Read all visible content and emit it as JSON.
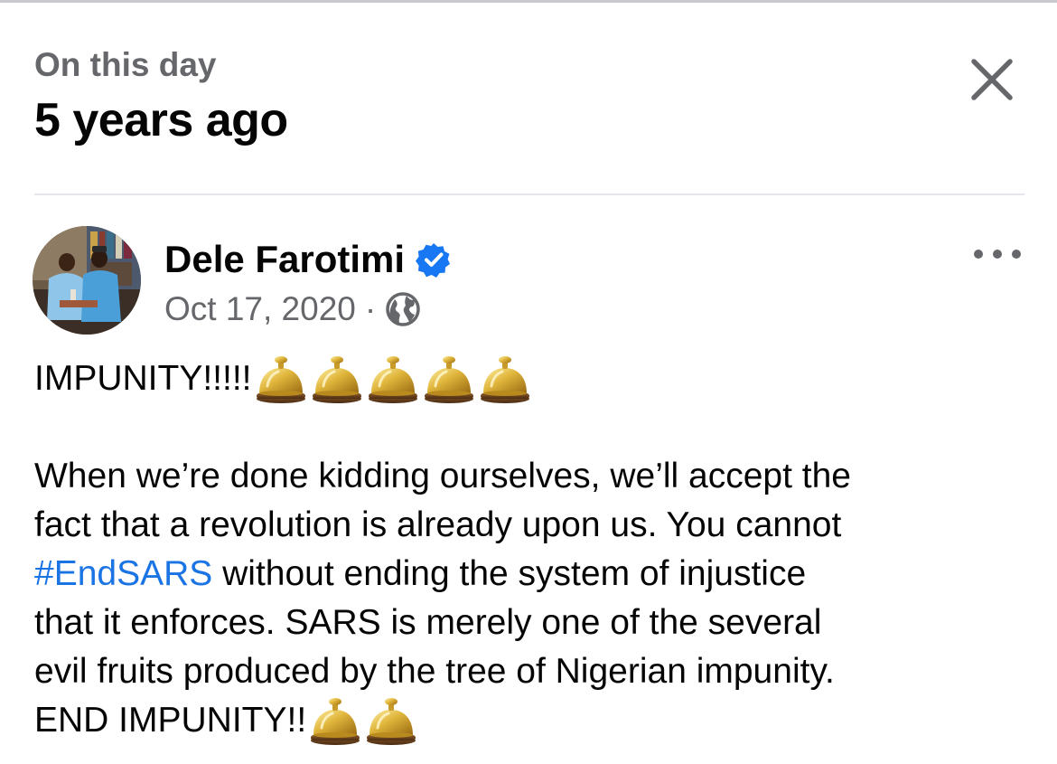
{
  "header": {
    "kicker": "On this day",
    "title": "5 years ago",
    "close_icon": "close-icon"
  },
  "post": {
    "author_name": "Dele Farotimi",
    "verified_icon": "verified-badge-icon",
    "date": "Oct 17, 2020",
    "separator": "·",
    "audience_icon": "globe-icon",
    "more_icon": "more-options-icon",
    "headline": "IMPUNITY!!!!!",
    "headline_emoji_count": 5,
    "body": {
      "line1": "When we’re done kidding ourselves, we’ll accept the",
      "line2": "fact that a revolution is already upon us. You cannot",
      "hashtag": "#EndSARS",
      "line3_rest": " without ending the system of injustice",
      "line4": "that it enforces. SARS is merely one of the several",
      "line5": "evil fruits produced by the tree of Nigerian impunity.",
      "closing": "END IMPUNITY!!"
    },
    "closing_emoji_count": 2,
    "emoji_icon": "bellhop-bell-icon"
  },
  "colors": {
    "text": "#050505",
    "secondary": "#65676b",
    "link": "#1b74e4",
    "verified": "#1877f2",
    "divider": "#e4e6eb"
  }
}
